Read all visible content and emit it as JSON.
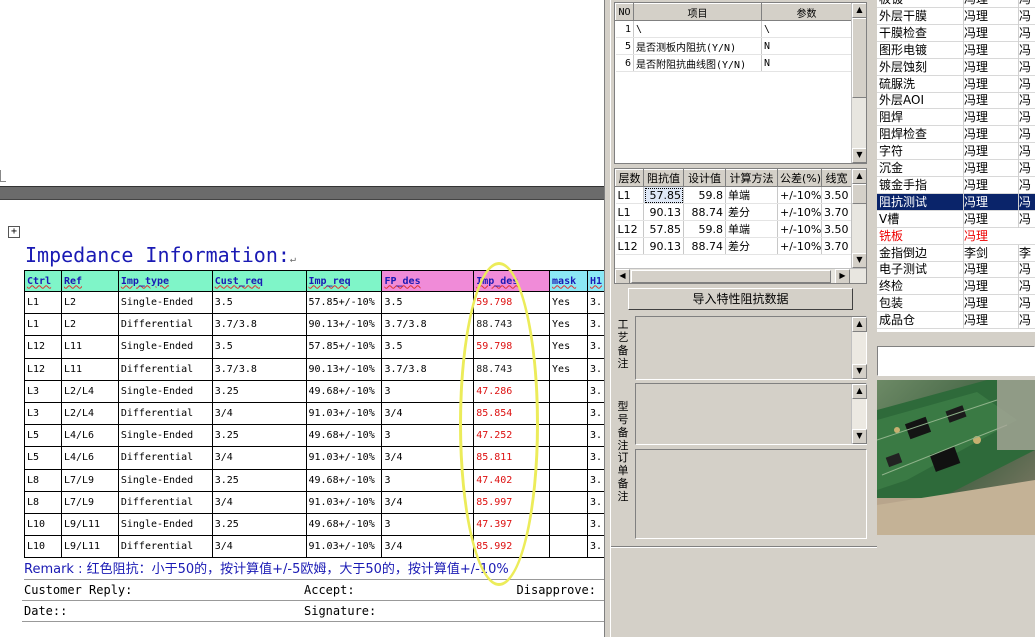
{
  "document": {
    "title": "Impedance Information:",
    "para_mark": "↵",
    "table": {
      "headers": [
        "Ctrl",
        "Ref",
        "Imp_type",
        "Cust_req",
        "Imp_req",
        "FP_des",
        "Imp_des",
        "mask",
        "H1"
      ],
      "rows": [
        [
          "L1",
          "L2",
          "Single-Ended",
          "3.5",
          "57.85+/-10%",
          "3.5",
          "59.798",
          "Yes",
          "3."
        ],
        [
          "L1",
          "L2",
          "Differential",
          "3.7/3.8",
          "90.13+/-10%",
          "3.7/3.8",
          "88.743",
          "Yes",
          "3."
        ],
        [
          "L12",
          "L11",
          "Single-Ended",
          "3.5",
          "57.85+/-10%",
          "3.5",
          "59.798",
          "Yes",
          "3."
        ],
        [
          "L12",
          "L11",
          "Differential",
          "3.7/3.8",
          "90.13+/-10%",
          "3.7/3.8",
          "88.743",
          "Yes",
          "3."
        ],
        [
          "L3",
          "L2/L4",
          "Single-Ended",
          "3.25",
          "49.68+/-10%",
          "3",
          "47.286",
          "",
          "3."
        ],
        [
          "L3",
          "L2/L4",
          "Differential",
          "3/4",
          "91.03+/-10%",
          "3/4",
          "85.854",
          "",
          "3."
        ],
        [
          "L5",
          "L4/L6",
          "Single-Ended",
          "3.25",
          "49.68+/-10%",
          "3",
          "47.252",
          "",
          "3."
        ],
        [
          "L5",
          "L4/L6",
          "Differential",
          "3/4",
          "91.03+/-10%",
          "3/4",
          "85.811",
          "",
          "3."
        ],
        [
          "L8",
          "L7/L9",
          "Single-Ended",
          "3.25",
          "49.68+/-10%",
          "3",
          "47.402",
          "",
          "3."
        ],
        [
          "L8",
          "L7/L9",
          "Differential",
          "3/4",
          "91.03+/-10%",
          "3/4",
          "85.997",
          "",
          "3."
        ],
        [
          "L10",
          "L9/L11",
          "Single-Ended",
          "3.25",
          "49.68+/-10%",
          "3",
          "47.397",
          "",
          "3."
        ],
        [
          "L10",
          "L9/L11",
          "Differential",
          "3/4",
          "91.03+/-10%",
          "3/4",
          "85.992",
          "",
          "3."
        ]
      ],
      "imp_des_colors": [
        "red",
        "dark",
        "red",
        "dark",
        "red",
        "red",
        "red",
        "red",
        "red",
        "red",
        "red",
        "red"
      ]
    },
    "remark": "Remark : 红色阻抗：小于50的，按计算值+/-5欧姆，大于50的，按计算值+/-10%",
    "customer_reply_label": "Customer Reply:",
    "accept_label": "Accept:",
    "disapprove_label": "Disapprove:",
    "date_label": "Date::",
    "signature_label": "Signature:",
    "colors": {
      "title": "#1a1ab4",
      "red_value": "#d11111",
      "highlight": "#ecec5a",
      "header_green": "#7ff5c8",
      "header_pink": "#f08bd8",
      "header_cyan": "#8be8f5"
    }
  },
  "params_grid": {
    "headers": [
      "NO",
      "项目",
      "参数"
    ],
    "rows": [
      [
        "1",
        "\\",
        "\\"
      ],
      [
        "5",
        "是否测板内阻抗(Y/N)",
        "N"
      ],
      [
        "6",
        "是否附阻抗曲线图(Y/N)",
        "N"
      ]
    ]
  },
  "impedance_grid": {
    "headers": [
      "层数",
      "阻抗值",
      "设计值",
      "计算方法",
      "公差(%)",
      "线宽"
    ],
    "rows": [
      [
        "L1",
        "57.85",
        "59.8",
        "单端",
        "+/-10%",
        "3.50"
      ],
      [
        "L1",
        "90.13",
        "88.74",
        "差分",
        "+/-10%",
        "3.70"
      ],
      [
        "L12",
        "57.85",
        "59.8",
        "单端",
        "+/-10%",
        "3.50"
      ],
      [
        "L12",
        "90.13",
        "88.74",
        "差分",
        "+/-10%",
        "3.70"
      ]
    ]
  },
  "import_button_label": "导入特性阻抗数据",
  "notes": {
    "process_note_label": "工艺备注",
    "model_note_label": "型号备注",
    "order_note_label": "订单备注"
  },
  "process_list": [
    {
      "name": "板镀",
      "a": "冯理",
      "b": "冯"
    },
    {
      "name": "外层干膜",
      "a": "冯理",
      "b": "冯"
    },
    {
      "name": "干膜检查",
      "a": "冯理",
      "b": "冯"
    },
    {
      "name": "图形电镀",
      "a": "冯理",
      "b": "冯"
    },
    {
      "name": "外层蚀刻",
      "a": "冯理",
      "b": "冯"
    },
    {
      "name": "硫脲洗",
      "a": "冯理",
      "b": "冯"
    },
    {
      "name": "外层AOI",
      "a": "冯理",
      "b": "冯"
    },
    {
      "name": "阻焊",
      "a": "冯理",
      "b": "冯"
    },
    {
      "name": "阻焊检查",
      "a": "冯理",
      "b": "冯"
    },
    {
      "name": "字符",
      "a": "冯理",
      "b": "冯"
    },
    {
      "name": "沉金",
      "a": "冯理",
      "b": "冯"
    },
    {
      "name": "镀金手指",
      "a": "冯理",
      "b": "冯"
    },
    {
      "name": "阻抗测试",
      "a": "冯理",
      "b": "冯"
    },
    {
      "name": "V槽",
      "a": "冯理",
      "b": "冯"
    },
    {
      "name": "铣板",
      "a": "冯理",
      "b": ""
    },
    {
      "name": "金指倒边",
      "a": "李剑",
      "b": "李"
    },
    {
      "name": "电子测试",
      "a": "冯理",
      "b": "冯"
    },
    {
      "name": "终检",
      "a": "冯理",
      "b": "冯"
    },
    {
      "name": "包装",
      "a": "冯理",
      "b": "冯"
    },
    {
      "name": "成品仓",
      "a": "冯理",
      "b": "冯"
    }
  ],
  "process_list_selected": "阻抗测试",
  "process_list_red": "铣板",
  "photo_description_icon": "pcb-photo"
}
